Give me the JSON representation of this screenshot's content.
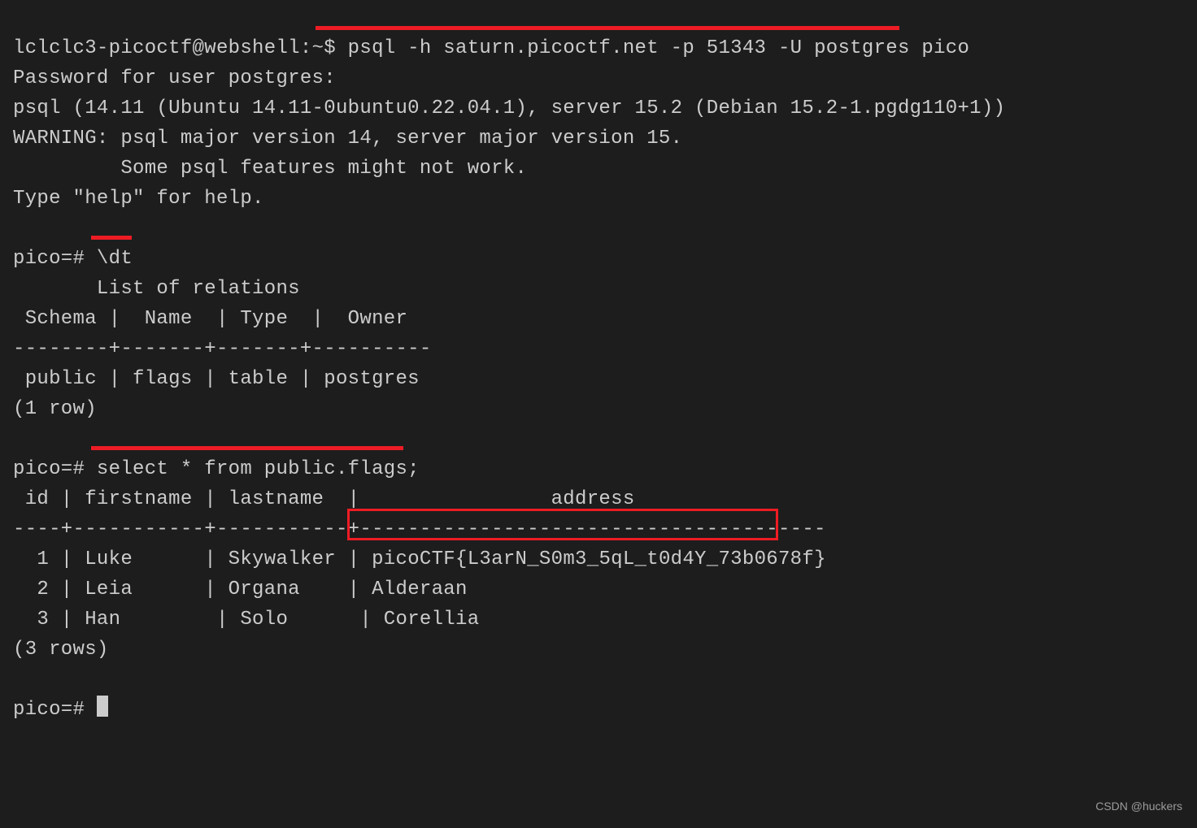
{
  "prompt": {
    "user_host": "lclclc3-picoctf@webshell",
    "cwd": "~",
    "sigil": "$"
  },
  "cmd1": "psql -h saturn.picoctf.net -p 51343 -U postgres pico",
  "lines": {
    "pwd_prompt": "Password for user postgres:",
    "version": "psql (14.11 (Ubuntu 14.11-0ubuntu0.22.04.1), server 15.2 (Debian 15.2-1.pgdg110+1))",
    "warn1": "WARNING: psql major version 14, server major version 15.",
    "warn2": "         Some psql features might not work.",
    "help": "Type \"help\" for help."
  },
  "psql_prompt": "pico=#",
  "cmd2": "\\dt",
  "relations": {
    "title": "       List of relations",
    "header": " Schema |  Name  | Type  |  Owner",
    "divider": "--------+-------+-------+----------",
    "row": " public | flags | table | postgres",
    "count": "(1 row)"
  },
  "cmd3": "select * from public.flags;",
  "flags": {
    "header": " id | firstname | lastname  |                address",
    "divider": "----+-----------+-----------+---------------------------------------",
    "rows": [
      {
        "id": "  1",
        "firstname": "Luke",
        "lastname": "Skywalker",
        "address": "picoCTF{L3arN_S0m3_5qL_t0d4Y_73b0678f}"
      },
      {
        "id": "  2",
        "firstname": "Leia",
        "lastname": "Organa   ",
        "address": "Alderaan"
      },
      {
        "id": "  3",
        "firstname": "Han ",
        "lastname": "Solo     ",
        "address": "Corellia"
      }
    ],
    "count": "(3 rows)"
  },
  "watermark": "CSDN @huckers"
}
